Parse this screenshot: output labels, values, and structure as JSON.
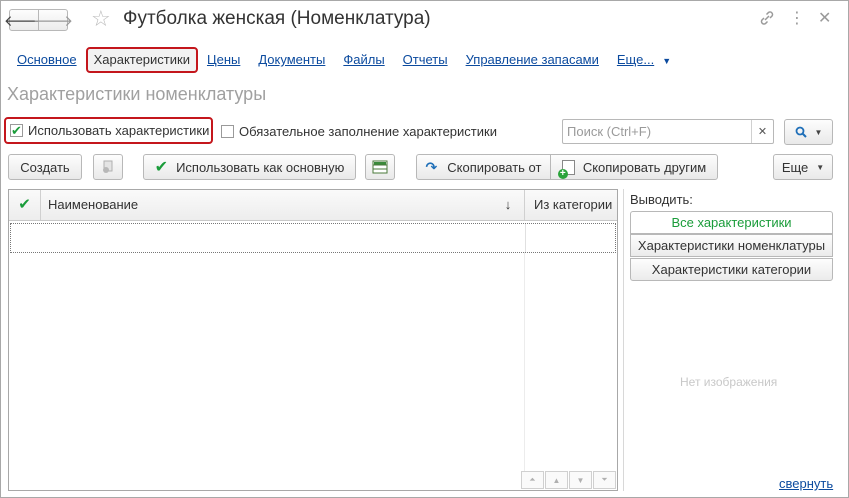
{
  "window": {
    "title": "Футболка женская (Номенклатура)",
    "back_glyph": "🡐",
    "forward_glyph": "🡒"
  },
  "tabs": [
    {
      "label": "Основное"
    },
    {
      "label": "Характеристики"
    },
    {
      "label": "Цены"
    },
    {
      "label": "Документы"
    },
    {
      "label": "Файлы"
    },
    {
      "label": "Отчеты"
    },
    {
      "label": "Управление запасами"
    },
    {
      "label": "Еще..."
    }
  ],
  "section": {
    "title": "Характеристики номенклатуры"
  },
  "options": {
    "use_characteristics": {
      "label": "Использовать характеристики",
      "checked": true
    },
    "mandatory_fill": {
      "label": "Обязательное заполнение характеристики",
      "checked": false
    }
  },
  "search": {
    "placeholder": "Поиск (Ctrl+F)",
    "value": ""
  },
  "toolbar": {
    "create_label": "Создать",
    "use_as_main_label": "Использовать как основную",
    "copy_from_label": "Скопировать от",
    "copy_to_label": "Скопировать другим",
    "more_label": "Еще"
  },
  "table": {
    "columns": {
      "name": "Наименование",
      "sort_glyph": "↓",
      "from_category": "Из категории"
    },
    "rows": []
  },
  "filter_panel": {
    "label": "Выводить:",
    "options": [
      {
        "label": "Все характеристики",
        "selected": true
      },
      {
        "label": "Характеристики номенклатуры",
        "selected": false
      },
      {
        "label": "Характеристики категории",
        "selected": false
      }
    ],
    "no_image": "Нет изображения",
    "collapse_label": "свернуть"
  },
  "colors": {
    "accent_green": "#1a9c3a",
    "link_blue": "#0b4a9e",
    "highlight_red": "#c4161c"
  }
}
